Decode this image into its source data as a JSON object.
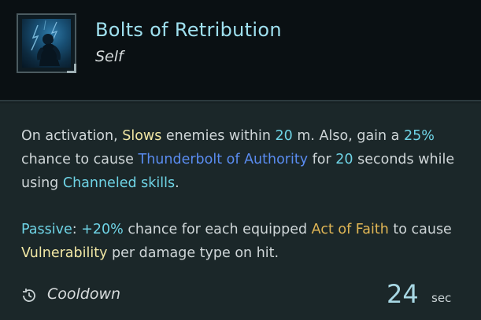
{
  "skill": {
    "title": "Bolts of Retribution",
    "target": "Self",
    "icon": "lightning-figure-icon"
  },
  "description": {
    "line1": {
      "t1": "On activation, ",
      "slows": "Slows",
      "t2": " enemies within ",
      "range": "20",
      "t3": " m. Also, gain a ",
      "chance": "25%",
      "t4": " chance to cause ",
      "thunderbolt": "Thunderbolt of Authority",
      "t5": " for ",
      "duration": "20",
      "t6": " seconds while using ",
      "channeled": "Channeled skills",
      "t7": "."
    },
    "line2": {
      "passive": "Passive",
      "t1": ": ",
      "bonus": "+20%",
      "t2": " chance for each equipped ",
      "act": "Act of Faith",
      "t3": " to cause ",
      "vuln": "Vulnerability",
      "t4": " per damage type on hit."
    }
  },
  "cooldown": {
    "label": "Cooldown",
    "icon": "cooldown-icon",
    "value": "24",
    "unit": "sec"
  },
  "colors": {
    "title": "#9fe0ef",
    "keyword_yellow": "#f1e7a4",
    "keyword_cyan": "#6fd4e6",
    "keyword_blue": "#5a8cf0",
    "keyword_gold": "#e0b655",
    "background": "#1b2729"
  }
}
